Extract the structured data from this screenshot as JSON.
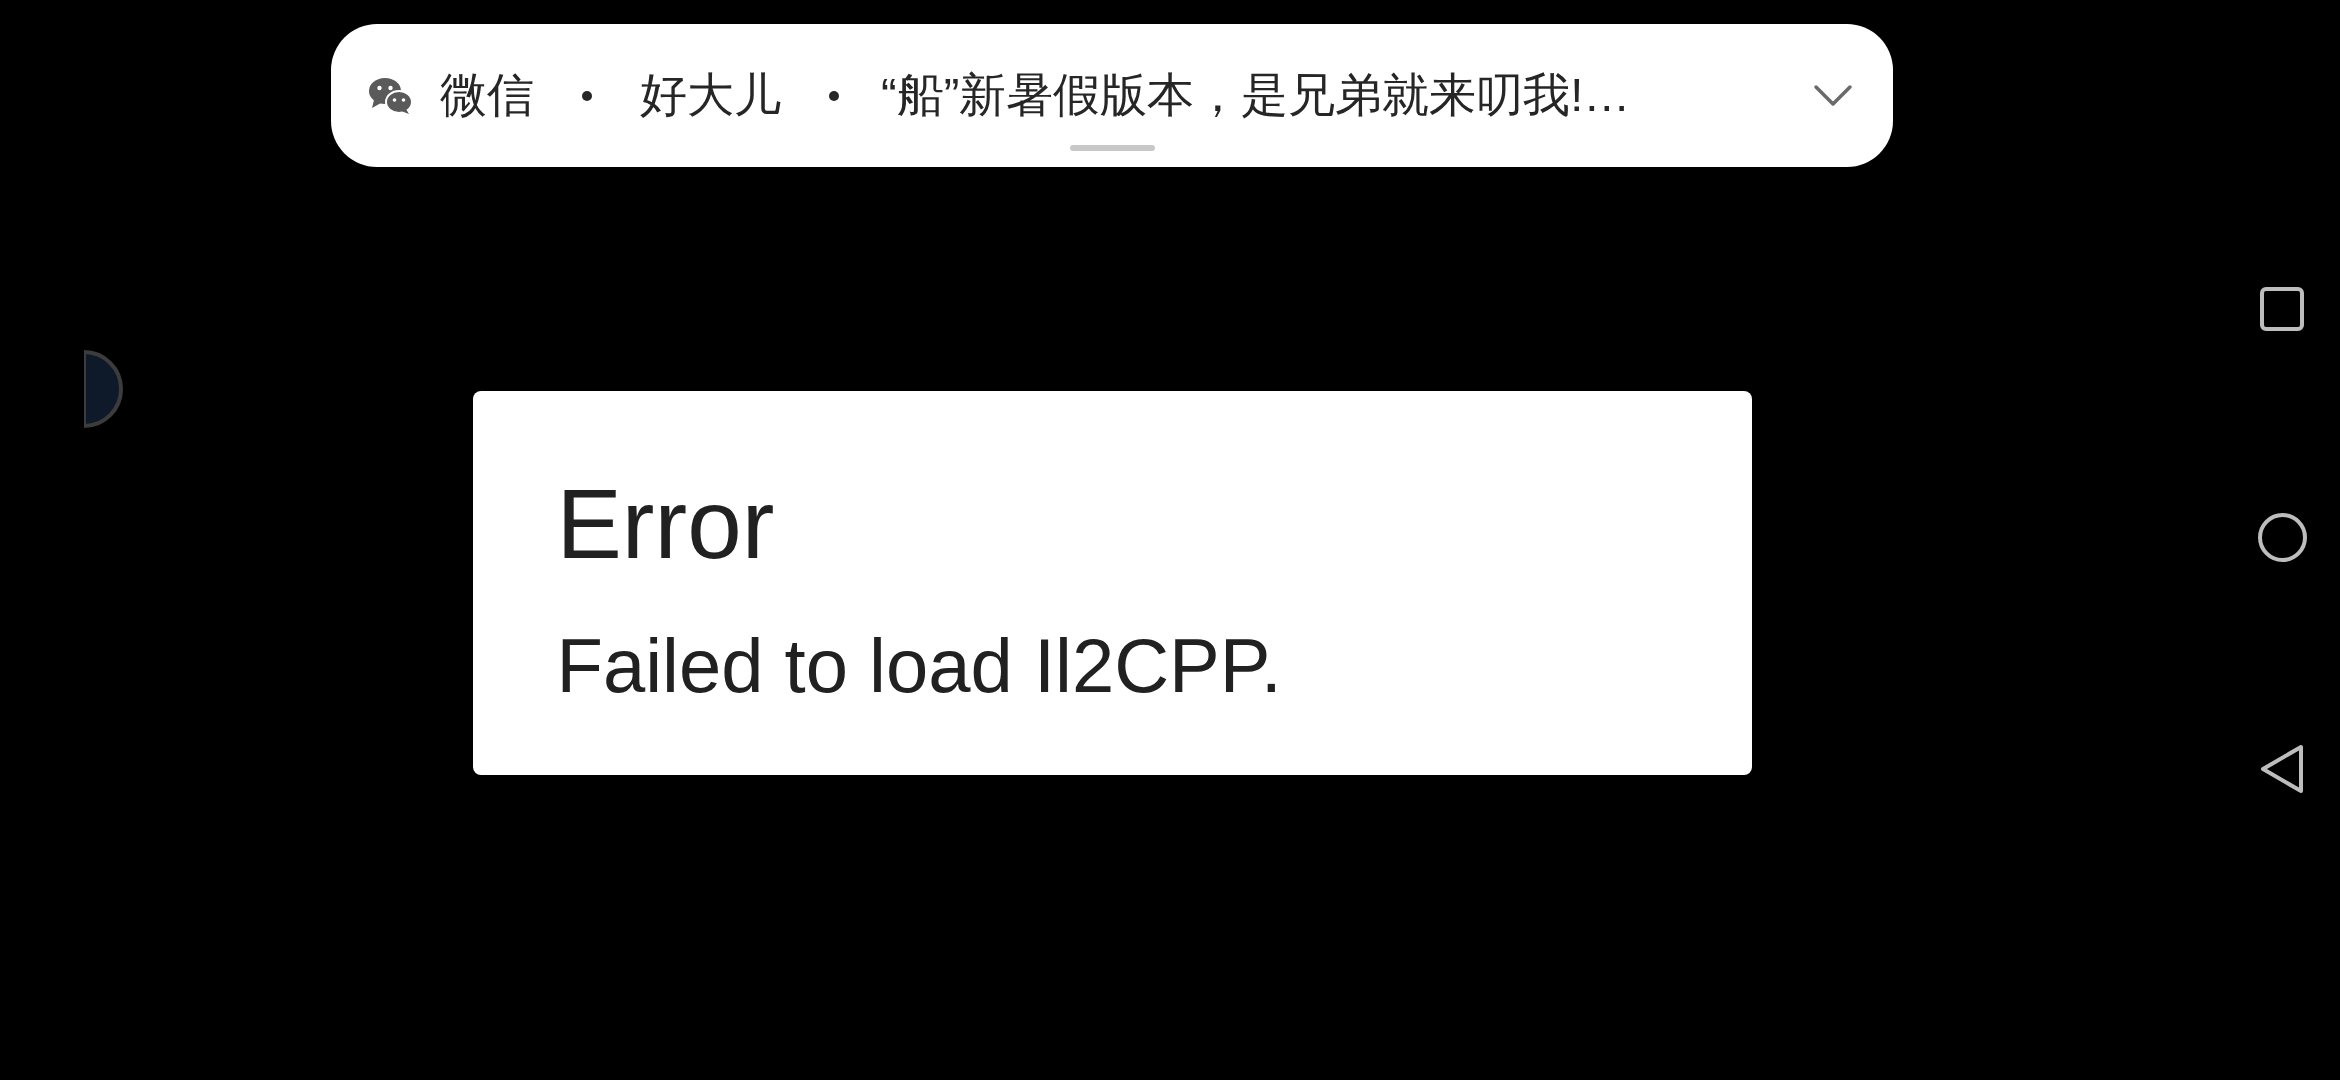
{
  "notification": {
    "app": "微信",
    "sender": "好大儿",
    "message": "“船”新暑假版本，是兄弟就来叨我!…"
  },
  "dialog": {
    "title": "Error",
    "message": "Failed to load Il2CPP."
  }
}
